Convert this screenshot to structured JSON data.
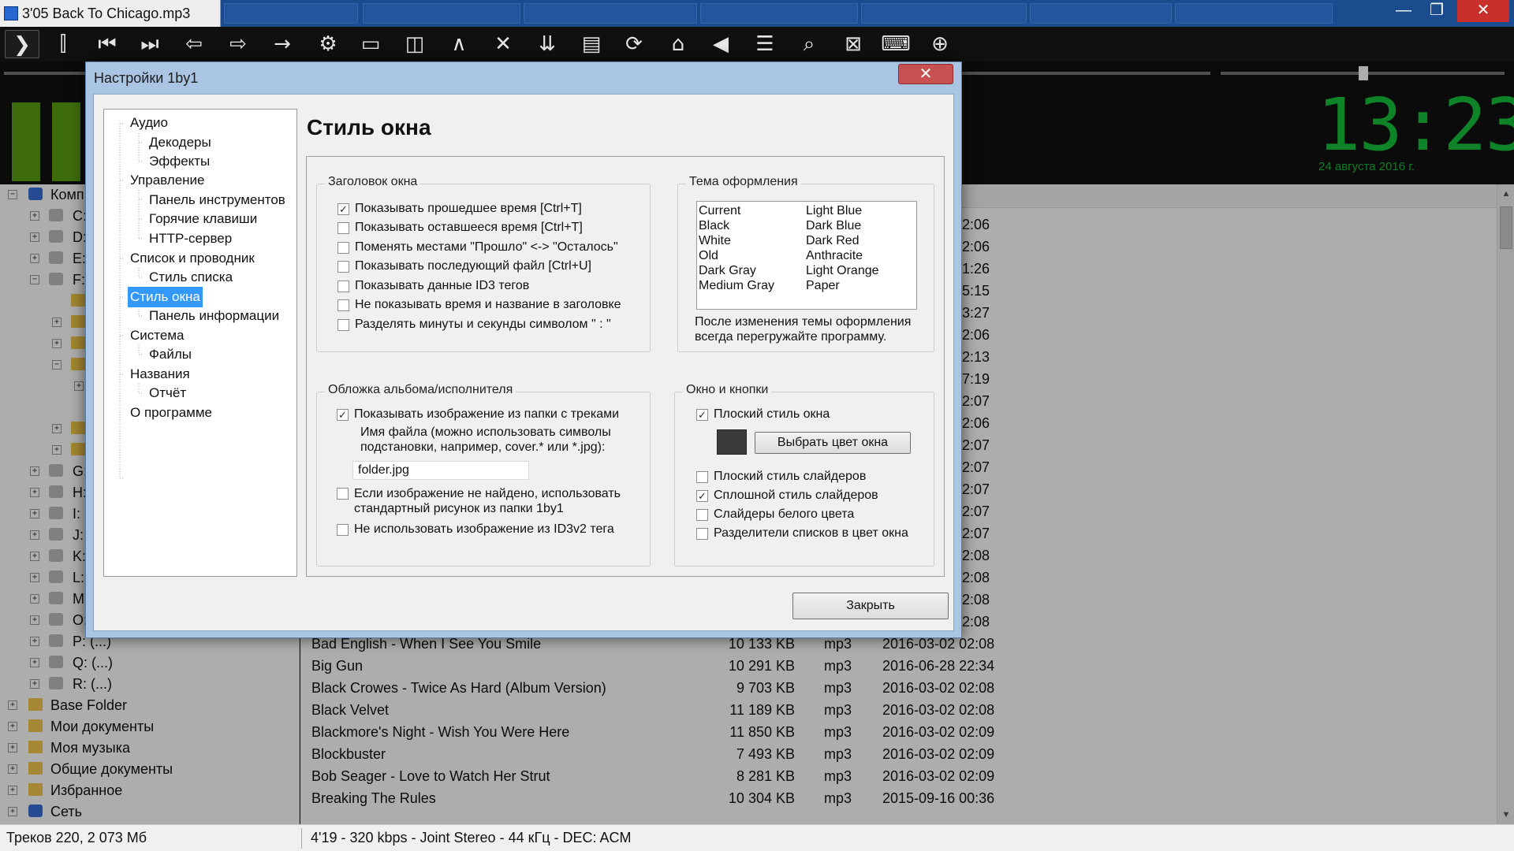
{
  "window": {
    "title": "3'05 Back To Chicago.mp3",
    "controls": {
      "minimize": "—",
      "maximize": "❐",
      "close": "✕"
    }
  },
  "toolbar_icons": [
    "play-icon",
    "play-pause-icon",
    "previous-track-icon",
    "next-track-icon",
    "back-folder-icon",
    "forward-folder-icon",
    "arrow-right-icon",
    "gear-icon",
    "window-layout-icon",
    "panel-layout-icon",
    "caret-up-icon",
    "close-icon",
    "sort-down-icon",
    "columns-icon",
    "refresh-icon",
    "home-icon",
    "volume-icon",
    "file-list-icon",
    "search-icon",
    "close-box-icon",
    "keyboard-icon",
    "add-circle-icon"
  ],
  "player": {
    "clock": "13:23",
    "date": "24 августа 2016 г.",
    "volume_percent": 0.47
  },
  "tree": {
    "top_item": "Комп",
    "drive_fragments": [
      "C:",
      "D:",
      "E:",
      "F:",
      "G:",
      "H:",
      "I:",
      "J:",
      "K:",
      "L:",
      "M:",
      "O:"
    ],
    "drives_visible": [
      "P: (...)",
      "Q: (...)",
      "R: (...)"
    ],
    "folders": [
      "Base Folder",
      "Мои документы",
      "Моя музыка",
      "Общие документы",
      "Избранное",
      "Сеть"
    ]
  },
  "file_rows_tail": [
    "2:06",
    "2:06",
    "1:26",
    "5:15",
    "3:27",
    "2:06",
    "2:13",
    "7:19",
    "2:07",
    "2:06",
    "2:07",
    "2:07",
    "2:07",
    "2:07",
    "2:07",
    "2:08",
    "2:08",
    "2:08",
    "2:08"
  ],
  "files": [
    {
      "name": "Bad English - When I See You Smile",
      "size": "10 133 KB",
      "ext": "mp3",
      "date": "2016-03-02 02:08"
    },
    {
      "name": "Big Gun",
      "size": "10 291 KB",
      "ext": "mp3",
      "date": "2016-06-28 22:34"
    },
    {
      "name": "Black Crowes - Twice As Hard (Album Version)",
      "size": "9 703 KB",
      "ext": "mp3",
      "date": "2016-03-02 02:08"
    },
    {
      "name": "Black Velvet",
      "size": "11 189 KB",
      "ext": "mp3",
      "date": "2016-03-02 02:08"
    },
    {
      "name": "Blackmore's Night - Wish You Were Here",
      "size": "11 850 KB",
      "ext": "mp3",
      "date": "2016-03-02 02:09"
    },
    {
      "name": "Blockbuster",
      "size": "7 493 KB",
      "ext": "mp3",
      "date": "2016-03-02 02:09"
    },
    {
      "name": "Bob Seager - Love to Watch Her Strut",
      "size": "8 281 KB",
      "ext": "mp3",
      "date": "2016-03-02 02:09"
    },
    {
      "name": "Breaking The Rules",
      "size": "10 304 KB",
      "ext": "mp3",
      "date": "2015-09-16 00:36"
    }
  ],
  "status": {
    "left": "Треков 220, 2 073 Мб",
    "right": "4'19 - 320 kbps - Joint Stereo - 44 кГц - DEC: ACM"
  },
  "dialog": {
    "title": "Настройки 1by1",
    "close_glyph": "✕",
    "nav": {
      "audio": "Аудио",
      "decoders": "Декодеры",
      "effects": "Эффекты",
      "control": "Управление",
      "toolbar_panel": "Панель инструментов",
      "hotkeys": "Горячие клавиши",
      "http": "HTTP-сервер",
      "list_explorer": "Список и проводник",
      "list_style": "Стиль списка",
      "window_style": "Стиль окна",
      "info_panel": "Панель информации",
      "system": "Система",
      "files": "Файлы",
      "names": "Названия",
      "report": "Отчёт",
      "about": "О программе"
    },
    "page_title": "Стиль окна",
    "group_title_window": {
      "title": "Заголовок окна",
      "options": [
        {
          "label": "Показывать прошедшее время [Ctrl+T]",
          "checked": true
        },
        {
          "label": "Показывать оставшееся время [Ctrl+T]",
          "checked": false
        },
        {
          "label": "Поменять местами \"Прошло\" <-> \"Осталось\"",
          "checked": false
        },
        {
          "label": "Показывать последующий файл [Ctrl+U]",
          "checked": false
        },
        {
          "label": "Показывать данные ID3 тегов",
          "checked": false
        },
        {
          "label": "Не показывать время и название в заголовке",
          "checked": false
        },
        {
          "label": "Разделять минуты и секунды символом \" : \"",
          "checked": false
        }
      ]
    },
    "group_theme": {
      "title": "Тема оформления",
      "themes_col1": [
        "Current",
        "Black",
        "White",
        "Old",
        "Dark Gray",
        "Medium Gray"
      ],
      "themes_col2": [
        "Light Blue",
        "Dark Blue",
        "Dark Red",
        "Anthracite",
        "Light Orange",
        "Paper"
      ],
      "note_line1": "После изменения темы оформления",
      "note_line2": "всегда перегружайте программу."
    },
    "group_cover": {
      "title": "Обложка альбома/исполнителя",
      "show_image": {
        "label": "Показывать изображение из папки с треками",
        "checked": true
      },
      "filename_hint_1": "Имя файла (можно использовать символы",
      "filename_hint_2": "подстановки, например, cover.* или *.jpg):",
      "filename_value": "folder.jpg",
      "fallback_1": "Если изображение не найдено, использовать",
      "fallback_2": "стандартный рисунок из папки 1by1",
      "fallback_checked": false,
      "no_id3": {
        "label": "Не использовать изображение из ID3v2 тега",
        "checked": false
      }
    },
    "group_window_buttons": {
      "title": "Окно и кнопки",
      "flat_window": {
        "label": "Плоский стиль окна",
        "checked": true
      },
      "color_button": "Выбрать цвет окна",
      "window_color": "#3a3a3a",
      "options": [
        {
          "label": "Плоский стиль слайдеров",
          "checked": false
        },
        {
          "label": "Сплошной стиль слайдеров",
          "checked": true
        },
        {
          "label": "Слайдеры белого цвета",
          "checked": false
        },
        {
          "label": "Разделители списков в цвет окна",
          "checked": false
        }
      ]
    },
    "close_button": "Закрыть"
  },
  "colors": {
    "accent": "#3399ff",
    "clock": "#16c13a",
    "vu": "#5ca013",
    "titlebar": "#1a4c8e"
  }
}
